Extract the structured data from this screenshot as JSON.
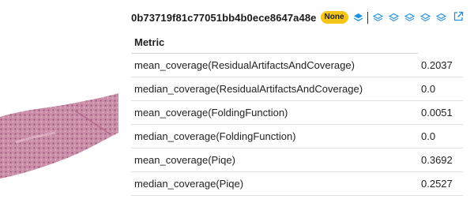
{
  "slide": {
    "id": "0b73719f81c77051bb4b0ece8647a48e",
    "badge": "None"
  },
  "icons": {
    "layer_active": "layers-filled-icon",
    "layers": [
      "layers-icon",
      "layers-icon",
      "layers-icon",
      "layers-icon",
      "layers-icon"
    ],
    "external": "external-link-icon"
  },
  "colors": {
    "badge_bg": "#f5c518",
    "link_blue": "#1f8fe0",
    "tissue": "#c47896"
  },
  "table": {
    "header": "Metric",
    "rows": [
      {
        "metric": "mean_coverage(ResidualArtifactsAndCoverage)",
        "value": "0.2037"
      },
      {
        "metric": "median_coverage(ResidualArtifactsAndCoverage)",
        "value": "0.0"
      },
      {
        "metric": "mean_coverage(FoldingFunction)",
        "value": "0.0051"
      },
      {
        "metric": "median_coverage(FoldingFunction)",
        "value": "0.0"
      },
      {
        "metric": "mean_coverage(Piqe)",
        "value": "0.3692"
      },
      {
        "metric": "median_coverage(Piqe)",
        "value": "0.2527"
      }
    ]
  }
}
